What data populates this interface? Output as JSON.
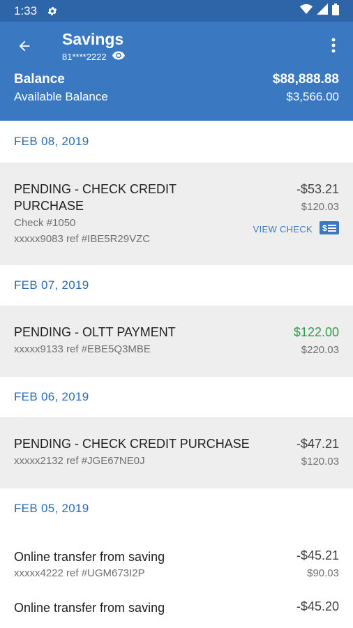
{
  "status": {
    "time": "1:33"
  },
  "header": {
    "title": "Savings",
    "account_masked": "81****2222",
    "balance_label": "Balance",
    "balance_value": "$88,888.88",
    "available_label": "Available Balance",
    "available_value": "$3,566.00"
  },
  "groups": [
    {
      "date": "FEB 08, 2019",
      "txns": [
        {
          "desc_line1": "PENDING - CHECK CREDIT",
          "desc_line2": "PURCHASE",
          "check": "Check #1050",
          "ref": "xxxxx9083 ref #IBE5R29VZC",
          "amount": "-$53.21",
          "balance": "$120.03",
          "action_label": "VIEW CHECK"
        }
      ]
    },
    {
      "date": "FEB 07, 2019",
      "txns": [
        {
          "desc": "PENDING - OLTT PAYMENT",
          "ref": "xxxxx9133 ref #EBE5Q3MBE",
          "amount": "$122.00",
          "balance": "$220.03"
        }
      ]
    },
    {
      "date": "FEB 06, 2019",
      "txns": [
        {
          "desc": "PENDING - CHECK CREDIT PURCHASE",
          "ref": "xxxxx2132 ref #JGE67NE0J",
          "amount": "-$47.21",
          "balance": "$120.03"
        }
      ]
    },
    {
      "date": "FEB 05, 2019",
      "txns": [
        {
          "desc": "Online transfer from saving",
          "ref": "xxxxx4222 ref #UGM673I2P",
          "amount": "-$45.21",
          "balance": "$90.03"
        },
        {
          "desc": "Online transfer from saving",
          "amount": "-$45.20"
        }
      ]
    }
  ],
  "colors": {
    "header": "#3a78c1",
    "statusbar": "#2e64a8",
    "date": "#2d6bb3",
    "positive": "#2e9e45"
  }
}
